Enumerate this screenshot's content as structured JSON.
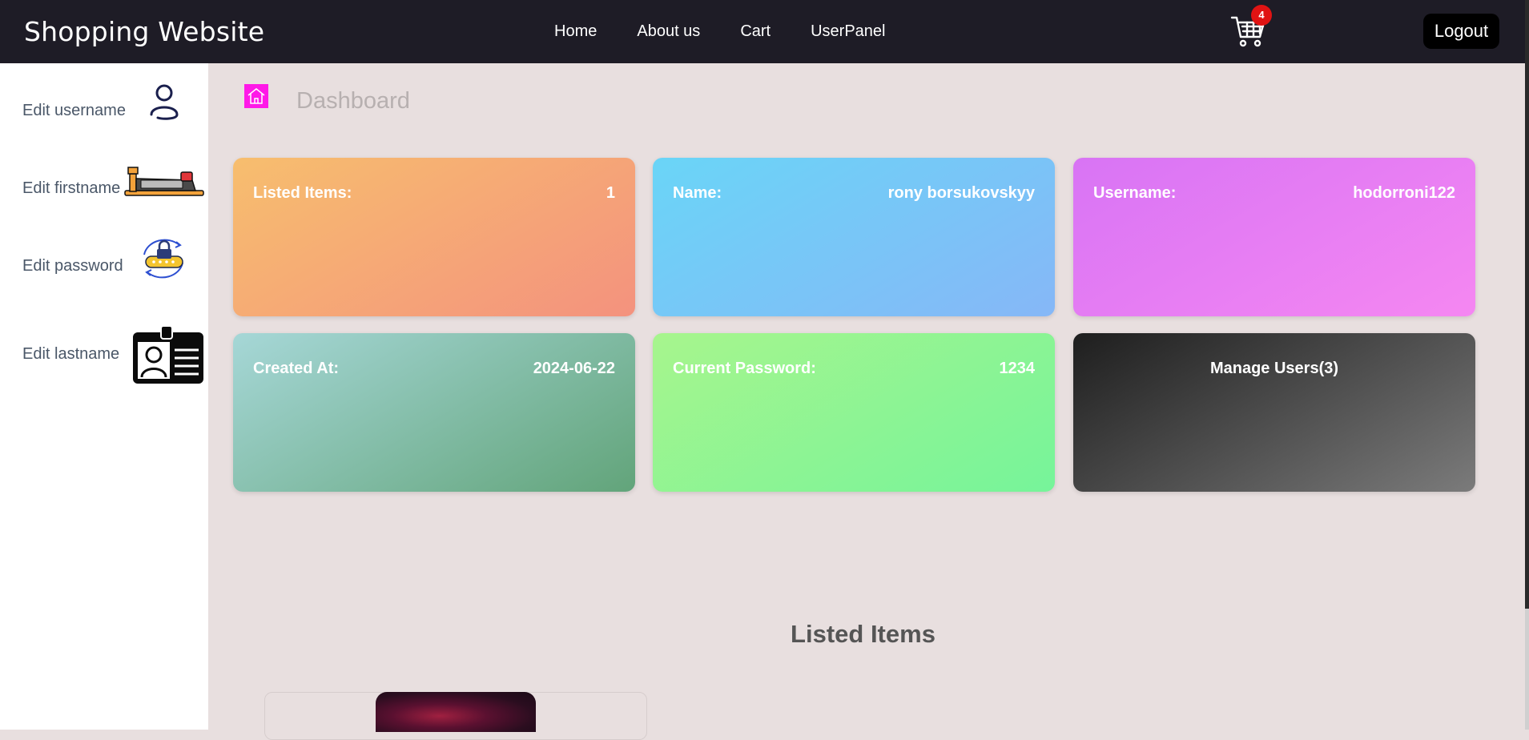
{
  "header": {
    "brand": "Shopping Website",
    "nav": [
      "Home",
      "About us",
      "Cart",
      "UserPanel"
    ],
    "cart_count": "4",
    "logout_label": "Logout"
  },
  "sidebar": {
    "items": [
      {
        "label": "Edit username",
        "icon": "user-icon"
      },
      {
        "label": "Edit firstname",
        "icon": "name-tag-icon"
      },
      {
        "label": "Edit password",
        "icon": "password-lock-icon"
      },
      {
        "label": "Edit lastname",
        "icon": "id-card-icon"
      }
    ]
  },
  "dashboard": {
    "title": "Dashboard",
    "cards": [
      {
        "label": "Listed Items:",
        "value": "1"
      },
      {
        "label": "Name:",
        "value": "rony borsukovskyy"
      },
      {
        "label": "Username:",
        "value": "hodorroni122"
      },
      {
        "label": "Created At:",
        "value": "2024-06-22"
      },
      {
        "label": "Current Password:",
        "value": "1234"
      },
      {
        "label": "Manage Users(3)"
      }
    ]
  },
  "listed": {
    "heading": "Listed Items"
  },
  "colors": {
    "navbar": "#1e1c26",
    "background": "#e8dfdf",
    "badge": "#e01313",
    "home_icon": "#ff19e8"
  }
}
